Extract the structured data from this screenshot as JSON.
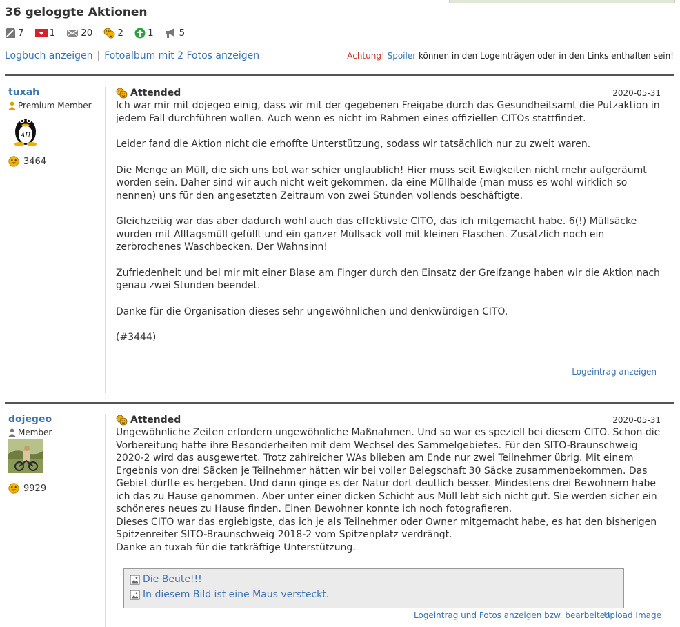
{
  "header": {
    "title": "36 geloggte Aktionen",
    "stats": [
      {
        "icon": "note-icon",
        "count": "7"
      },
      {
        "icon": "flag-icon",
        "count": "1"
      },
      {
        "icon": "mail-icon",
        "count": "20"
      },
      {
        "icon": "attended-icon",
        "count": "2"
      },
      {
        "icon": "up-arrow-icon",
        "count": "1"
      },
      {
        "icon": "megaphone-icon",
        "count": "5"
      }
    ],
    "logbook_link": "Logbuch anzeigen",
    "separator": "|",
    "album_link": "Fotoalbum mit 2 Fotos anzeigen",
    "warning_prefix": "Achtung!",
    "warning_spoiler": "Spoiler",
    "warning_suffix": "können in den Logeinträgen oder in den Links enthalten sein!"
  },
  "entries": [
    {
      "user": "tuxah",
      "role": "Premium Member",
      "avatar": "tux-penguin",
      "avatar_text": "AH",
      "finds": "3464",
      "log_type": "Attended",
      "date": "2020-05-31",
      "paragraphs": [
        "Ich war mir mit dojegeo einig, dass wir mit der gegebenen Freigabe durch das Gesundheitsamt die Putzaktion in jedem Fall durchführen wollen. Auch wenn es nicht im Rahmen eines offiziellen CITOs stattfindet.",
        "Leider fand die Aktion nicht die erhoffte Unterstützung, sodass wir tatsächlich nur zu zweit waren.",
        "Die Menge an Müll, die sich uns bot war schier unglaublich! Hier muss seit Ewigkeiten nicht mehr aufgeräumt worden sein. Daher sind wir auch nicht weit gekommen, da eine Müllhalde (man muss es wohl wirklich so nennen) uns für den angesetzten Zeitraum von zwei Stunden vollends beschäftigte.",
        "Gleichzeitig war das aber dadurch wohl auch das effektivste CITO, das ich mitgemacht habe. 6(!) Müllsäcke wurden mit Alltagsmüll gefüllt und ein ganzer Müllsack voll mit kleinen Flaschen. Zusätzlich noch ein zerbrochenes Waschbecken. Der Wahnsinn!",
        "Zufriedenheit und bei mir mit einer Blase am Finger durch den Einsatz der Greifzange haben wir die Aktion nach genau zwei Stunden beendet.",
        "Danke für die Organisation dieses sehr ungewöhnlichen und denkwürdigen CITO.",
        "(#3444)"
      ],
      "footer_link": "Logeintrag anzeigen"
    },
    {
      "user": "dojegeo",
      "role": "Member",
      "avatar": "photo",
      "finds": "9929",
      "log_type": "Attended",
      "date": "2020-05-31",
      "lines": [
        "Ungewöhnliche Zeiten erfordern ungewöhnliche Maßnahmen. Und so war es speziell bei diesem CITO. Schon die Vorbereitung hatte ihre Besonderheiten mit dem Wechsel des Sammelgebietes. Für den SITO-Braunschweig 2020-2 wird das ausgewertet. Trotz zahlreicher WAs blieben am Ende nur zwei Teilnehmer übrig. Mit einem Ergebnis von drei Säcken je Teilnehmer hätten wir bei voller Belegschaft 30 Säcke zusammenbekommen. Das Gebiet dürfte es hergeben. Und dann ginge es der Natur dort deutlich besser. Mindestens drei Bewohnern habe ich das zu Hause genommen. Aber unter einer dicken Schicht aus Müll lebt sich nicht gut. Sie werden sicher ein schöneres neues zu Hause finden. Einen Bewohner konnte ich noch fotografieren.",
        "Dieses CITO war das ergiebigste, das ich je als Teilnehmer oder Owner mitgemacht habe, es hat den bisherigen Spitzenreiter SITO-Braunschweig 2018-2 vom Spitzenplatz verdrängt.",
        "Danke an tuxah für die tatkräftige Unterstützung."
      ],
      "images": [
        "Die Beute!!!",
        "In diesem Bild ist eine Maus versteckt."
      ],
      "footer_link": "Logeintrag und Fotos anzeigen bzw. bearbeiten",
      "upload_link": "Upload Image"
    }
  ]
}
